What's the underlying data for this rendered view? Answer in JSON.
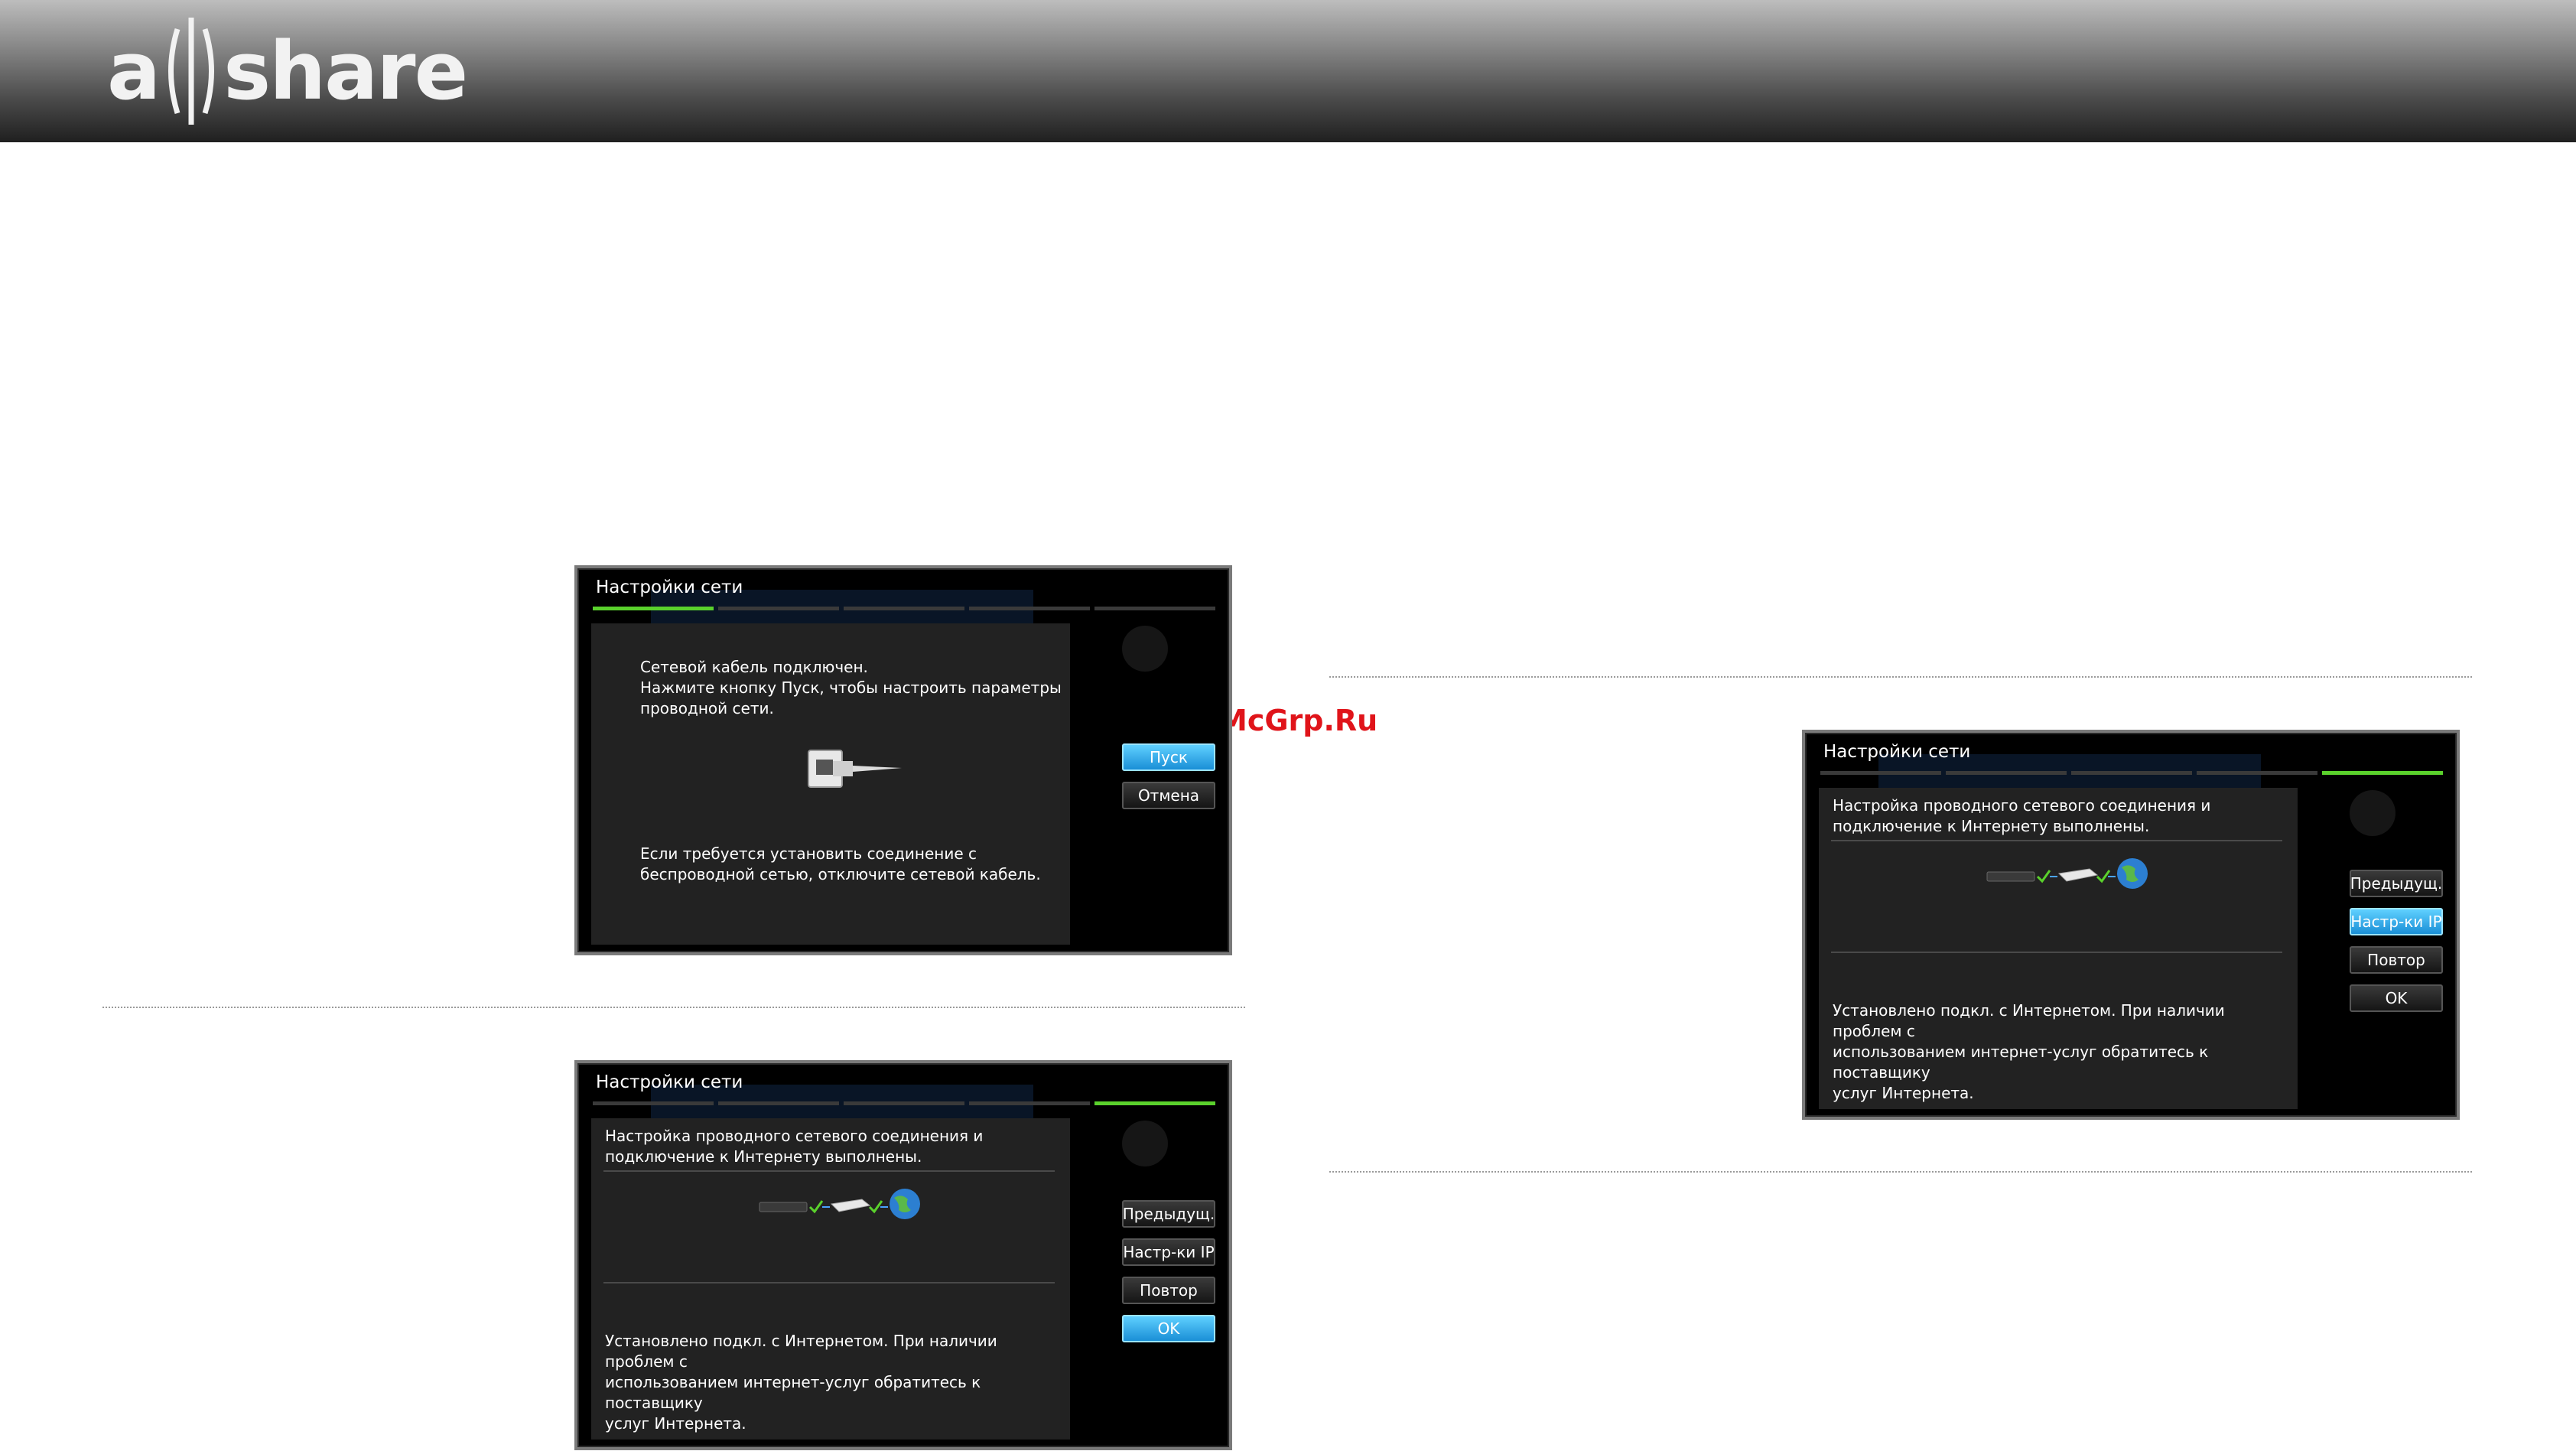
{
  "brand": {
    "logo_left": "a",
    "logo_right": "share"
  },
  "watermark": "McGrp.Ru",
  "dialogs": {
    "cable": {
      "title": "Настройки сети",
      "message": "Сетевой кабель подключен.\nНажмите кнопку Пуск, чтобы настроить параметры\nпроводной сети.",
      "note": "Если требуется установить соединение с\nбеспроводной сетью, отключите сетевой кабель.",
      "buttons": [
        "Пуск",
        "Отмена"
      ],
      "selected_button": "Пуск",
      "progress_step": 1,
      "progress_total": 5
    },
    "done": {
      "title": "Настройки сети",
      "message": "Настройка проводного сетевого соединения и\nподключение к Интернету выполнены.",
      "note": "Установлено подкл. с Интернетом. При наличии проблем с\nиспользованием интернет-услуг обратитесь к поставщику\nуслуг Интернета.",
      "buttons": [
        "Предыдущ.",
        "Настр-ки IP",
        "Повтор",
        "OK"
      ],
      "selected_button": "OK",
      "progress_step": 5,
      "progress_total": 5
    },
    "done_ip": {
      "title": "Настройки сети",
      "message": "Настройка проводного сетевого соединения и\nподключение к Интернету выполнены.",
      "note": "Установлено подкл. с Интернетом. При наличии проблем с\nиспользованием интернет-услуг обратитесь к поставщику\nуслуг Интернета.",
      "buttons": [
        "Предыдущ.",
        "Настр-ки IP",
        "Повтор",
        "OK"
      ],
      "selected_button": "Настр-ки IP",
      "progress_step": 5,
      "progress_total": 5
    }
  },
  "colors": {
    "accent_green": "#5ad12c",
    "selected_blue": "#1a8fd6",
    "watermark_red": "#e0141a"
  },
  "icons": {
    "cable": "network-cable-icon",
    "connection": "tv-router-globe-icon"
  }
}
